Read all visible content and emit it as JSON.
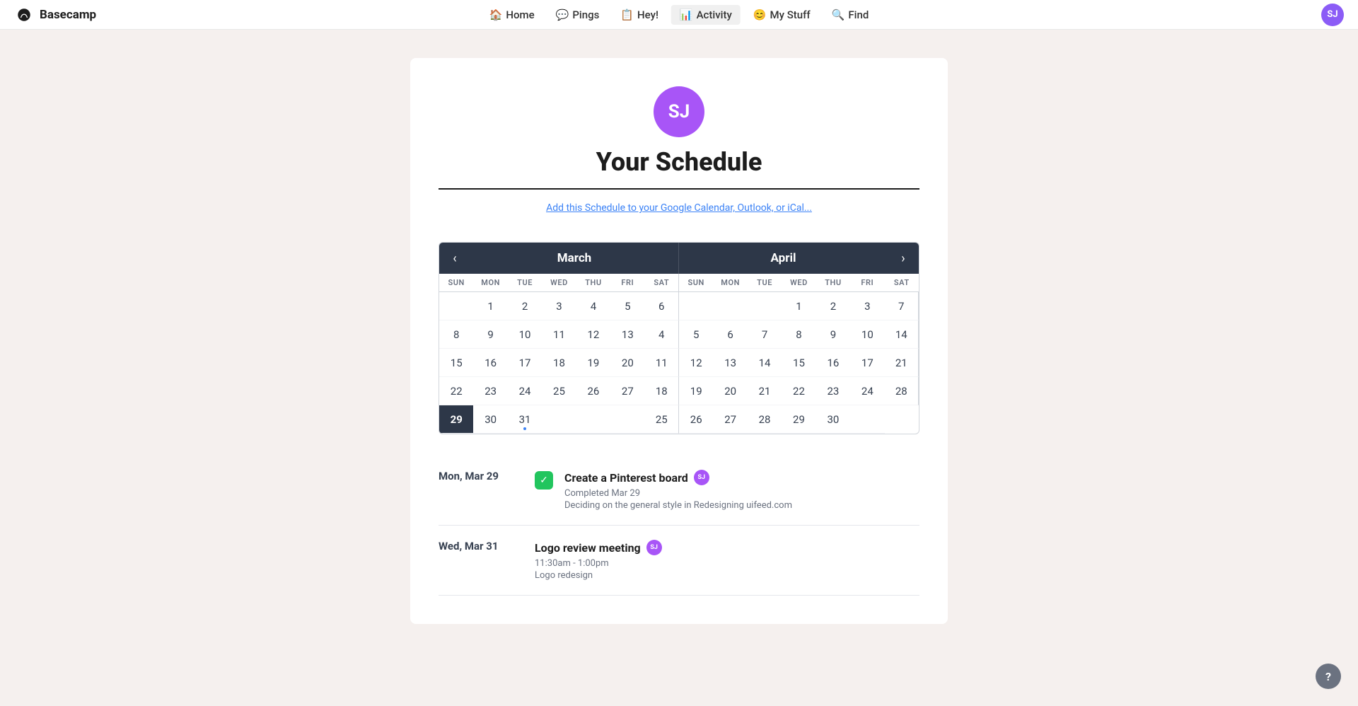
{
  "brand": {
    "name": "Basecamp"
  },
  "nav": {
    "items": [
      {
        "id": "home",
        "label": "Home",
        "icon": "🏠"
      },
      {
        "id": "pings",
        "label": "Pings",
        "icon": "💬"
      },
      {
        "id": "hey",
        "label": "Hey!",
        "icon": "📋"
      },
      {
        "id": "activity",
        "label": "Activity",
        "icon": "📊",
        "active": true
      },
      {
        "id": "mystuff",
        "label": "My Stuff",
        "icon": "😊"
      },
      {
        "id": "find",
        "label": "Find",
        "icon": "🔍"
      }
    ]
  },
  "user": {
    "initials": "SJ",
    "avatar_color": "#a855f7"
  },
  "page": {
    "title": "Your Schedule",
    "calendar_link": "Add this Schedule to your Google Calendar, Outlook, or iCal..."
  },
  "calendar": {
    "prev_label": "‹",
    "next_label": "›",
    "month1": "March",
    "month2": "April",
    "day_headers": [
      "SUN",
      "MON",
      "TUE",
      "WED",
      "THU",
      "FRI",
      "SAT",
      "SUN",
      "MON",
      "TUE",
      "WED",
      "THU",
      "FRI",
      "SAT"
    ],
    "rows": [
      [
        "",
        "1",
        "2",
        "3",
        "4",
        "5",
        "6",
        "",
        "",
        "",
        "1",
        "2",
        "3"
      ],
      [
        "7",
        "8",
        "9",
        "10",
        "11",
        "12",
        "13",
        "4",
        "5",
        "6",
        "7",
        "8",
        "9",
        "10"
      ],
      [
        "14",
        "15",
        "16",
        "17",
        "18",
        "19",
        "20",
        "11",
        "12",
        "13",
        "14",
        "15",
        "16",
        "17"
      ],
      [
        "21",
        "22",
        "23",
        "24",
        "25",
        "26",
        "27",
        "18",
        "19",
        "20",
        "21",
        "22",
        "23",
        "24"
      ],
      [
        "28",
        "29",
        "30",
        "31",
        "",
        "",
        "",
        "25",
        "26",
        "27",
        "28",
        "29",
        "30",
        ""
      ]
    ],
    "today_cell": "29",
    "today_row": 4,
    "today_col": 1,
    "dot_cell_date": "31",
    "dot_row": 4,
    "dot_col": 3
  },
  "schedule_items": [
    {
      "date": "Mon, Mar 29",
      "has_check": true,
      "title": "Create a Pinterest board",
      "show_avatar": true,
      "subtitle": "Completed Mar 29",
      "project": "Deciding on the general style in Redesigning uifeed.com"
    },
    {
      "date": "Wed, Mar 31",
      "has_check": false,
      "title": "Logo review meeting",
      "show_avatar": true,
      "subtitle": "11:30am - 1:00pm",
      "project": "Logo redesign"
    }
  ]
}
